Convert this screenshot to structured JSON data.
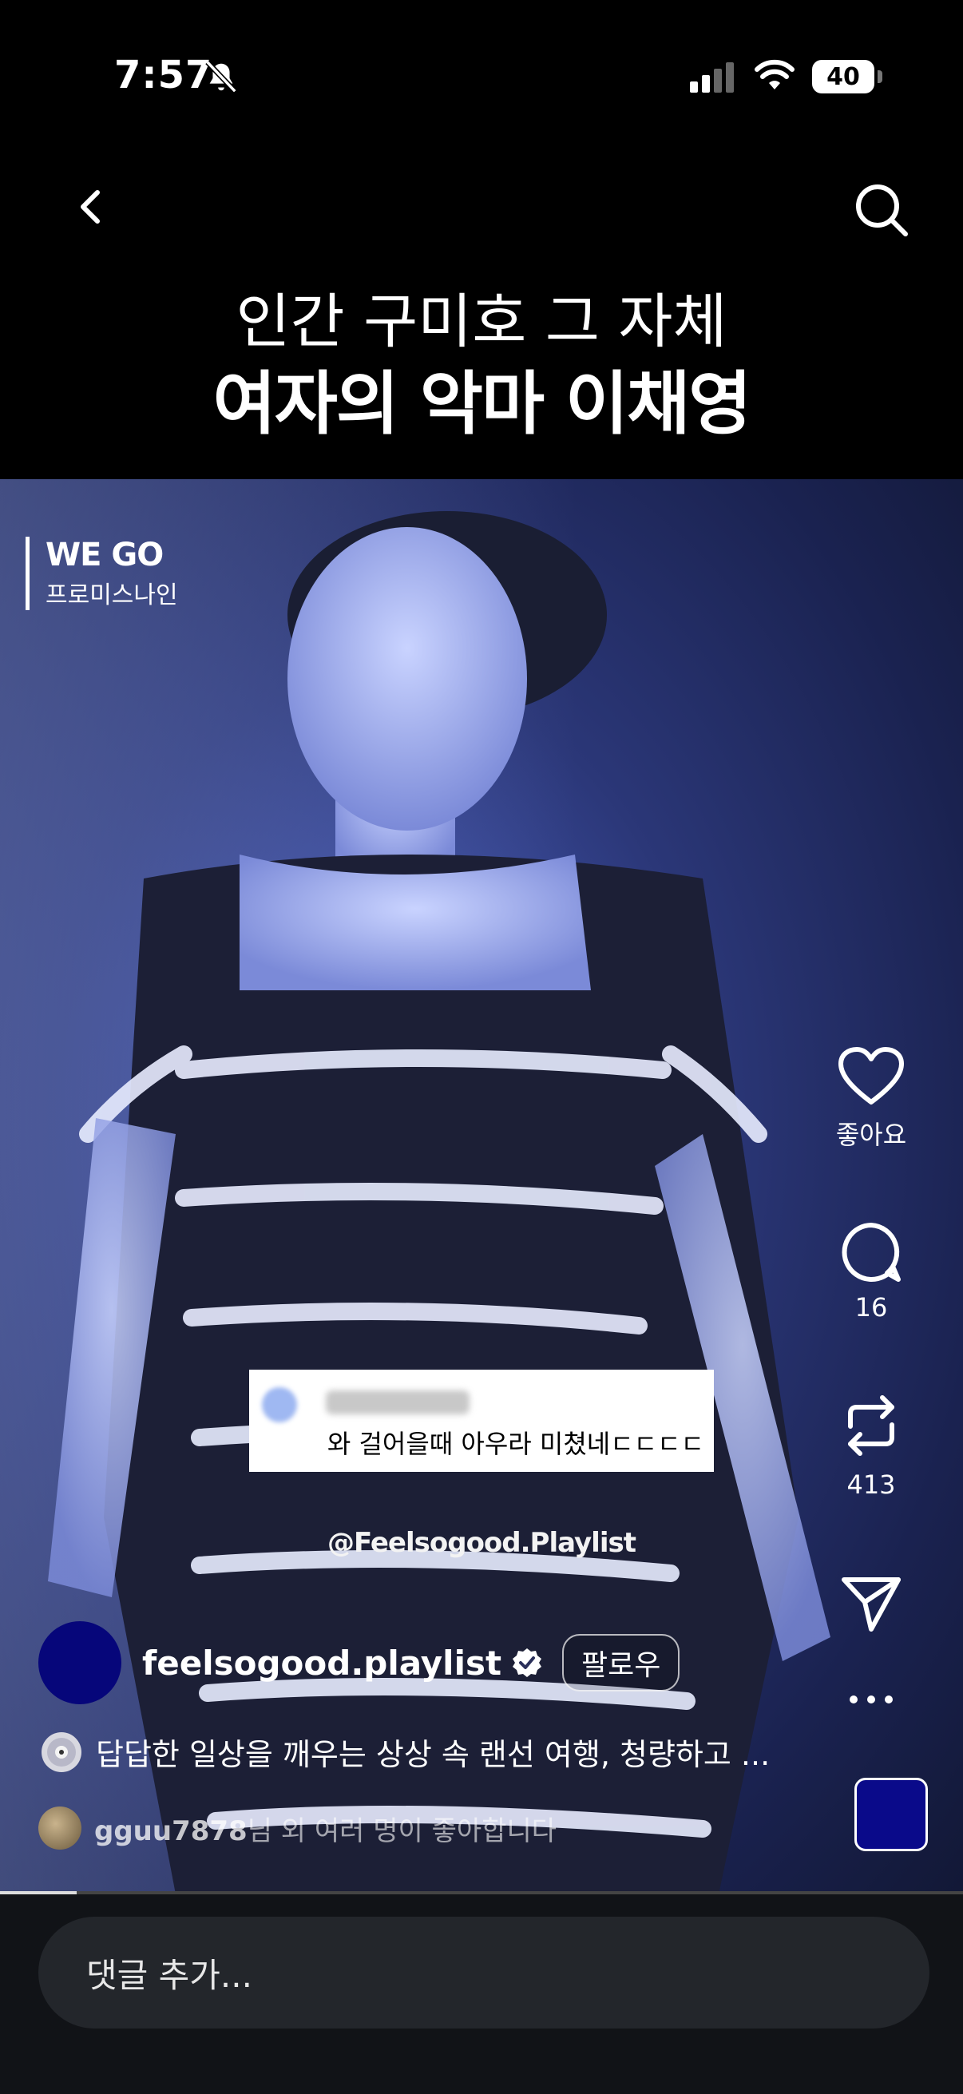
{
  "status_bar": {
    "time": "7:57",
    "battery": "40"
  },
  "headline": {
    "line1": "인간 구미호 그 자체",
    "line2": "여자의 악마 이채영"
  },
  "video": {
    "watermark_title": "WE GO",
    "watermark_sub": "프로미스나인",
    "overlay_comment": "와 걸어을때 아우라 미쳤네ㄷㄷㄷㄷ",
    "handle_watermark": "@Feelsogood.Playlist",
    "progress": 0.08
  },
  "actions": {
    "like_label": "좋아요",
    "comment_count": "16",
    "repost_count": "413"
  },
  "author": {
    "username": "feelsogood.playlist",
    "follow_label": "팔로우"
  },
  "caption": "답답한 일상을 깨우는 상상 속 랜선 여행, 청량하고 ...",
  "likes": {
    "user": "gguu7878",
    "suffix": "님 외 여러 명이 좋아합니다"
  },
  "comment_box": {
    "placeholder": "댓글 추가..."
  },
  "colors": {
    "avatar": "#06067a",
    "video_tint": "#3a4aa8"
  }
}
